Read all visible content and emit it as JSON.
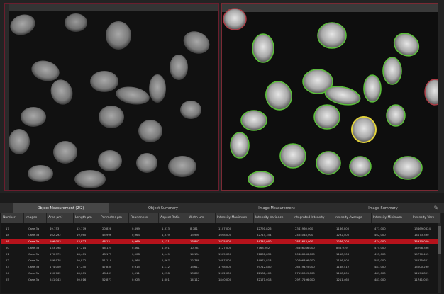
{
  "tabs": [
    {
      "label": "Object Measurement (2/2)",
      "active": true
    },
    {
      "label": "Object Summary",
      "active": false
    },
    {
      "label": "Image Measurement",
      "active": false
    },
    {
      "label": "Image Summary",
      "active": false
    }
  ],
  "toolbar": {
    "left_icon": "table-icon",
    "right_icon": "wrench-icon"
  },
  "columns": [
    "Number",
    "Images",
    "Area μm²",
    "Length μm",
    "Perimeter μm",
    "Roundness",
    "Aspect Ratio",
    "Width μm",
    "Intensity Maximum",
    "Intensity Variance",
    "Integrated Intensity",
    "Intensity Average",
    "Intensity Minimum",
    "Intensity Vars"
  ],
  "rows": [
    [
      "17",
      "Case 3a",
      "49,753",
      "12,179",
      "20,828",
      "0,899",
      "1,313",
      "8,781",
      "1107,000",
      "42791,826",
      "2341960,000",
      "1186,000",
      "471,000",
      "13469,0624"
    ],
    [
      "18",
      "Case 3a",
      "162,292",
      "19,060",
      "45,996",
      "0,964",
      "1,379",
      "13,990",
      "1698,000",
      "52715,354",
      "2454048,000",
      "1292,400",
      "462,000",
      "14173,390"
    ],
    [
      "19",
      "Case 3a",
      "196,003",
      "13,827",
      "46,12",
      "0,969",
      "1,131",
      "13,842",
      "1825,000",
      "84740,000",
      "2871613,000",
      "1276,200",
      "474,000",
      "35910,000"
    ],
    [
      "20",
      "Case 3a",
      "133,798",
      "17,214",
      "46,124",
      "0,861",
      "1,591",
      "10,761",
      "1127,000",
      "7768,262",
      "16856046,000",
      "838,919",
      "474,000",
      "14298,396"
    ],
    [
      "21",
      "Case 3a",
      "170,979",
      "18,401",
      "48,175",
      "0,908",
      "1,149",
      "14,134",
      "1505,000",
      "31861,835",
      "20406546,000",
      "1118,906",
      "495,000",
      "19770,415"
    ],
    [
      "22",
      "Case 3a",
      "186,978",
      "20,872",
      "51,119",
      "0,864",
      "1,667",
      "12,768",
      "1687,000",
      "34974,813",
      "30406496,000",
      "1126,000",
      "585,000",
      "14535,601"
    ],
    [
      "23",
      "Case 3a",
      "174,000",
      "17,240",
      "47,830",
      "0,915",
      "1,112",
      "13,617",
      "1798,000",
      "29712,800",
      "26519425,000",
      "1188,412",
      "481,000",
      "15000,290"
    ],
    [
      "24",
      "Case 3a",
      "190,762",
      "18,001",
      "48,461",
      "0,911",
      "1,258",
      "13,807",
      "1902,000",
      "42188,400",
      "27130009,000",
      "1198,801",
      "481,000",
      "12194,801"
    ],
    [
      "25",
      "Case 3a",
      "241,043",
      "20,016",
      "52,871",
      "0,925",
      "1,601",
      "14,112",
      "1840,000",
      "32171,018",
      "29717196,000",
      "1211,460",
      "483,000",
      "11741,005"
    ]
  ],
  "selected_row": 2,
  "colors": {
    "accent": "#b5121b",
    "outline": "#5bbf3a",
    "selected_cell": "#e1d23a"
  }
}
